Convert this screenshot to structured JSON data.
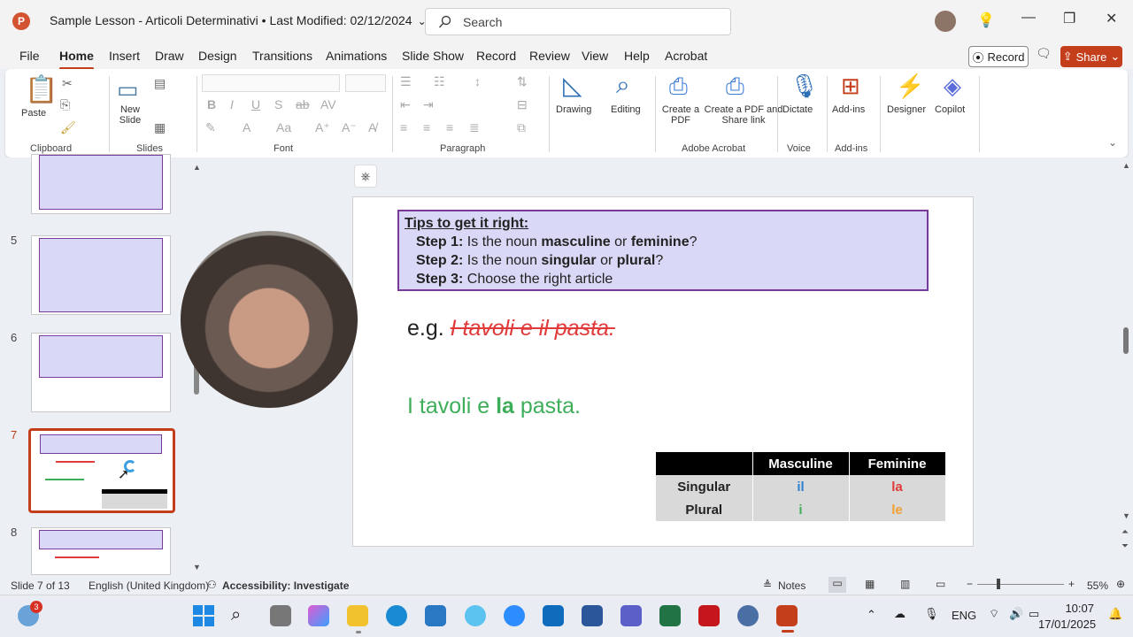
{
  "title_bar": {
    "doc_title": "Sample Lesson - Articoli Determinativi • Last Modified: 02/12/2024",
    "search_placeholder": "Search"
  },
  "menu_tabs": [
    "File",
    "Home",
    "Insert",
    "Draw",
    "Design",
    "Transitions",
    "Animations",
    "Slide Show",
    "Record",
    "Review",
    "View",
    "Help",
    "Acrobat"
  ],
  "active_tab": "Home",
  "record_label": "Record",
  "share_label": "Share",
  "ribbon": {
    "clipboard": {
      "paste": "Paste",
      "group": "Clipboard"
    },
    "slides": {
      "new_slide": "New Slide",
      "group": "Slides"
    },
    "font_group": "Font",
    "paragraph_group": "Paragraph",
    "drawing": "Drawing",
    "editing": "Editing",
    "adobe": {
      "create_pdf": "Create a PDF",
      "create_share": "Create a PDF and Share link",
      "group": "Adobe Acrobat"
    },
    "voice": {
      "dictate": "Dictate",
      "group": "Voice"
    },
    "addins": {
      "label": "Add-ins",
      "group": "Add-ins"
    },
    "designer": "Designer",
    "copilot": "Copilot"
  },
  "thumbnails": [
    {
      "num": "5"
    },
    {
      "num": "6"
    },
    {
      "num": "7"
    },
    {
      "num": "8"
    }
  ],
  "slide": {
    "tips_title": "Tips to get it right:",
    "steps": [
      {
        "label": "Step 1:",
        "pre": "Is the noun ",
        "b1": "masculine",
        "mid": " or ",
        "b2": "feminine",
        "post": "?"
      },
      {
        "label": "Step 2:",
        "pre": "Is the noun ",
        "b1": "singular",
        "mid": " or ",
        "b2": "plural",
        "post": "?"
      },
      {
        "label": "Step 3:",
        "pre": "Choose the right article",
        "b1": "",
        "mid": "",
        "b2": "",
        "post": ""
      }
    ],
    "eg_prefix": "e.g.",
    "eg_wrong": "I tavoli e il pasta.",
    "correct_pre": "I tavoli e ",
    "correct_bold": "la",
    "correct_post": " pasta.",
    "table": {
      "headers": [
        "",
        "Masculine",
        "Feminine"
      ],
      "rows": [
        [
          "Singular",
          "il",
          "la"
        ],
        [
          "Plural",
          "i",
          "le"
        ]
      ]
    }
  },
  "status": {
    "slide": "Slide 7 of 13",
    "language": "English (United Kingdom)",
    "accessibility": "Accessibility: Investigate",
    "notes": "Notes",
    "zoom": "55%"
  },
  "taskbar": {
    "notification_badge": "3",
    "lang": "ENG",
    "time": "10:07",
    "date": "17/01/2025"
  },
  "colors": {
    "accent": "#c43e1c",
    "tips_bg": "#d9d9f7",
    "tips_border": "#7a3a9a",
    "wrong": "#e03a3a",
    "correct": "#3fae5a",
    "il": "#2f7fd1",
    "la": "#e03a3a",
    "i": "#3fae5a",
    "le": "#f0a030"
  }
}
